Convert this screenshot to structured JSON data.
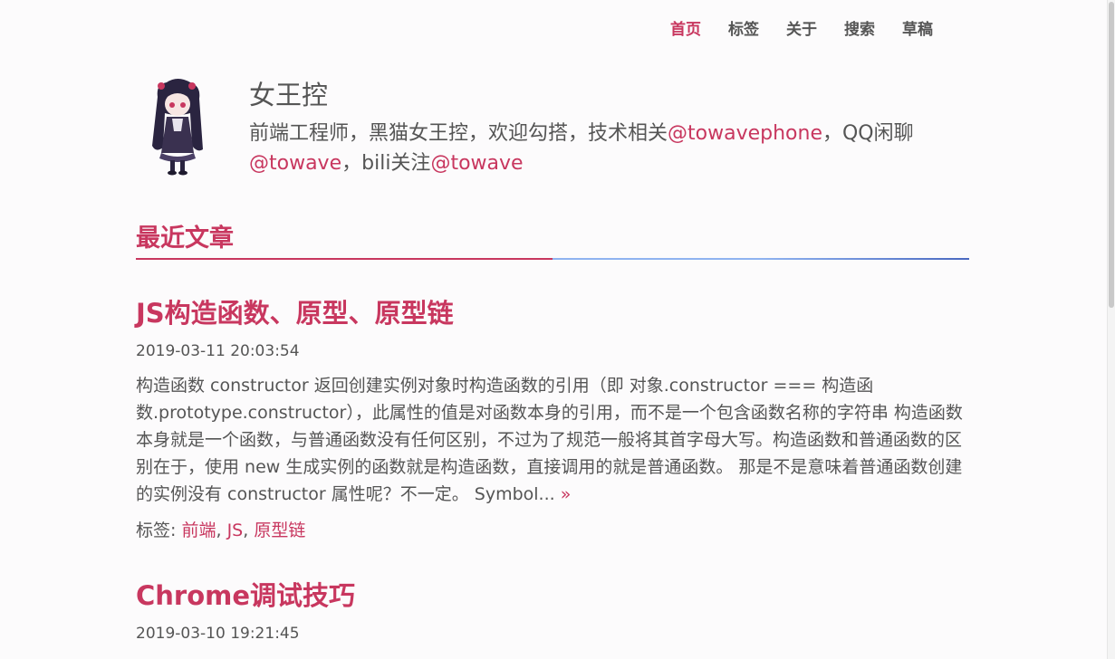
{
  "nav": {
    "items": [
      {
        "label": "首页",
        "active": true
      },
      {
        "label": "标签",
        "active": false
      },
      {
        "label": "关于",
        "active": false
      },
      {
        "label": "搜索",
        "active": false
      },
      {
        "label": "草稿",
        "active": false
      }
    ]
  },
  "profile": {
    "name": "女王控",
    "bio_line1_text": "前端工程师，黑猫女王控，欢迎勾搭，技术相关",
    "bio_link1": "@towavephone",
    "bio_mid_text": "，QQ闲聊",
    "bio_link2": "@towave",
    "bio_mid2_text": "，bili关注",
    "bio_link3": "@towave"
  },
  "section": {
    "title": "最近文章"
  },
  "posts": [
    {
      "title": "JS构造函数、原型、原型链",
      "date": "2019-03-11 20:03:54",
      "excerpt": "构造函数 constructor 返回创建实例对象时构造函数的引用（即 对象.constructor === 构造函数.prototype.constructor），此属性的值是对函数本身的引用，而不是一个包含函数名称的字符串 构造函数本身就是一个函数，与普通函数没有任何区别，不过为了规范一般将其首字母大写。构造函数和普通函数的区别在于，使用 new 生成实例的函数就是构造函数，直接调用的就是普通函数。 那是不是意味着普通函数创建的实例没有 constructor 属性呢？不一定。 Symbol... ",
      "more": "»",
      "tags_label": "标签: ",
      "tags": [
        "前端",
        "JS",
        "原型链"
      ]
    },
    {
      "title": "Chrome调试技巧",
      "date": "2019-03-10 19:21:45"
    }
  ],
  "colors": {
    "accent": "#c8375f",
    "text": "#555555",
    "rule_blue_light": "#8fb3f0",
    "rule_blue_dark": "#4a68c0"
  }
}
